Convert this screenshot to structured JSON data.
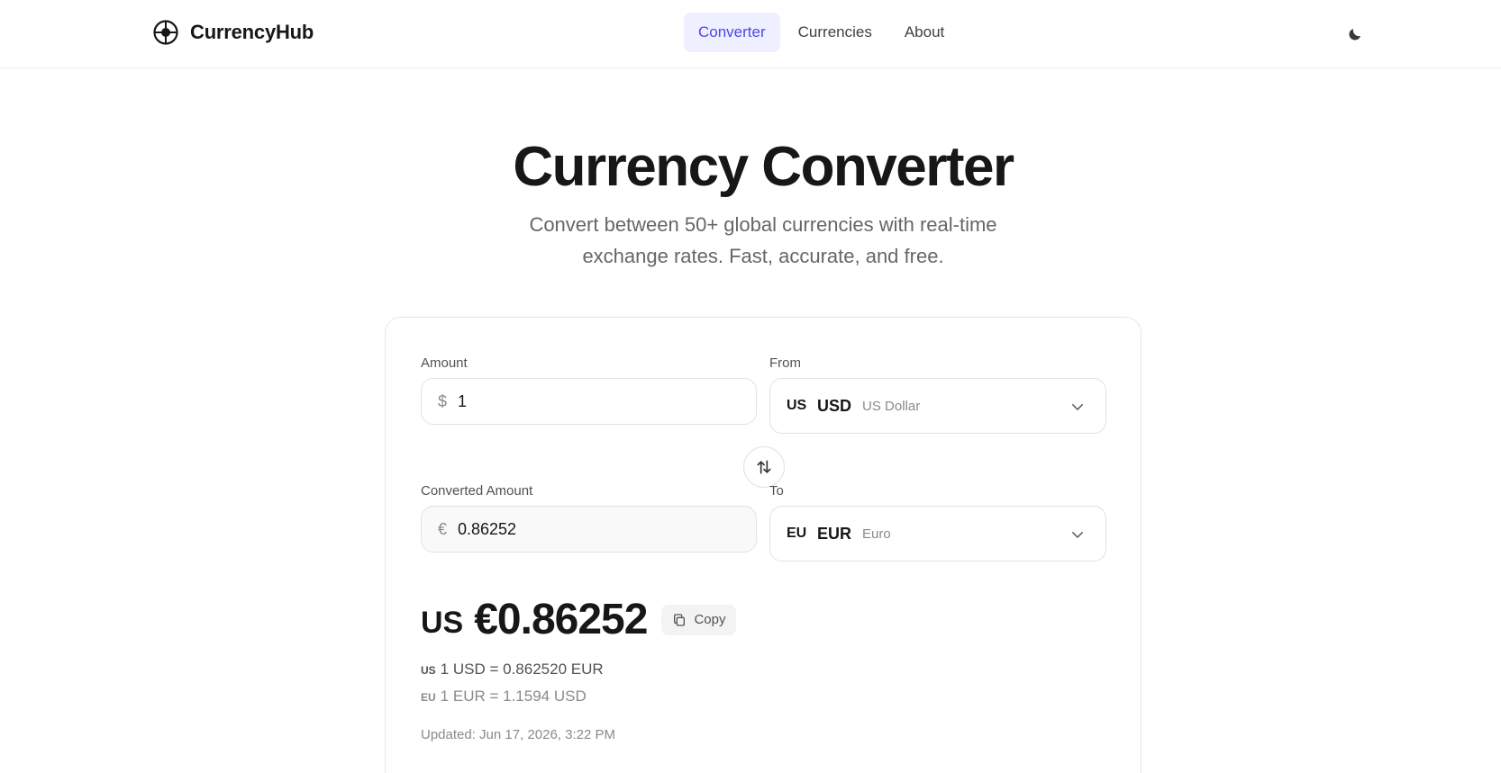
{
  "header": {
    "brand": "CurrencyHub",
    "nav": [
      {
        "label": "Converter",
        "active": true
      },
      {
        "label": "Currencies",
        "active": false
      },
      {
        "label": "About",
        "active": false
      }
    ],
    "theme_icon": "moon-icon"
  },
  "hero": {
    "title": "Currency Converter",
    "subtitle": "Convert between 50+ global currencies with real-time exchange rates. Fast, accurate, and free."
  },
  "converter": {
    "amount_label": "Amount",
    "amount_prefix": "$",
    "amount_value": "1",
    "from_label": "From",
    "from": {
      "flag": "US",
      "code": "USD",
      "name": "US Dollar"
    },
    "converted_label": "Converted Amount",
    "converted_prefix": "€",
    "converted_value": "0.86252",
    "to_label": "To",
    "to": {
      "flag": "EU",
      "code": "EUR",
      "name": "Euro"
    },
    "swap_icon": "swap-arrows-icon"
  },
  "result": {
    "flag": "US",
    "value": "€0.86252",
    "copy_label": "Copy",
    "rate_primary": {
      "flag": "US",
      "text": "1 USD = 0.862520 EUR"
    },
    "rate_inverse": {
      "flag": "EU",
      "text": "1 EUR = 1.1594 USD"
    },
    "updated": "Updated: Jun 17, 2026, 3:22 PM"
  },
  "colors": {
    "accent": "#4f46e5",
    "accent_bg": "#eef0ff",
    "text": "#171717",
    "muted": "#8a8a8a",
    "border": "#e2e2e2"
  }
}
